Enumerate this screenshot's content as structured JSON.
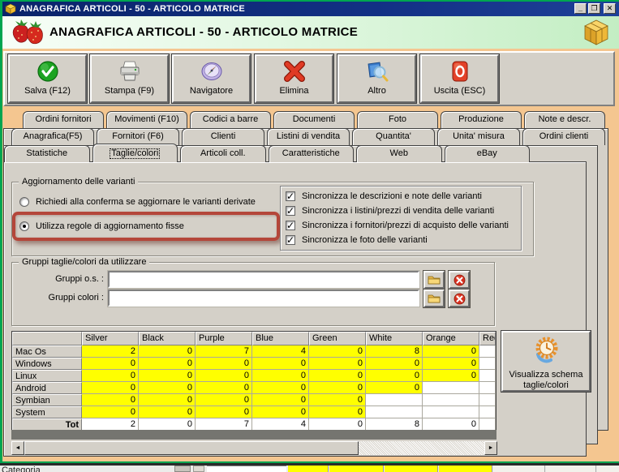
{
  "window": {
    "title": "ANAGRAFICA ARTICOLI - 50 - ARTICOLO MATRICE",
    "controls": {
      "minimize": "_",
      "maximize": "❐",
      "close": "✕"
    }
  },
  "header": {
    "title": "ANAGRAFICA ARTICOLI - 50 - ARTICOLO MATRICE"
  },
  "toolbar": {
    "buttons": [
      "Salva (F12)",
      "Stampa (F9)",
      "Navigatore",
      "Elimina",
      "Altro",
      "Uscita (ESC)"
    ]
  },
  "tabs": {
    "row1": [
      "Ordini fornitori",
      "Movimenti (F10)",
      "Codici a barre",
      "Documenti",
      "Foto",
      "Produzione",
      "Note e descr."
    ],
    "row2": [
      "Anagrafica(F5)",
      "Fornitori (F6)",
      "Clienti",
      "Listini di vendita",
      "Quantita'",
      "Unita' misura",
      "Ordini clienti"
    ],
    "row3": [
      "Statistiche",
      "Taglie/colori",
      "Articoli coll.",
      "Caratteristiche",
      "Web",
      "eBay"
    ],
    "active": "Taglie/colori"
  },
  "variants": {
    "group_title": "Aggiornamento delle varianti",
    "radio_options": [
      {
        "label": "Richiedi alla conferma se aggiornare le varianti derivate",
        "selected": false
      },
      {
        "label": "Utilizza regole di aggiornamento fisse",
        "selected": true
      }
    ],
    "sync_options": [
      {
        "label": "Sincronizza le descrizioni e note delle varianti",
        "checked": true
      },
      {
        "label": "Sincronizza i listini/prezzi di vendita delle varianti",
        "checked": true
      },
      {
        "label": "Sincronizza i fornitori/prezzi di acquisto delle varianti",
        "checked": true
      },
      {
        "label": "Sincronizza le foto delle varianti",
        "checked": true
      }
    ]
  },
  "groups": {
    "group_title": "Gruppi taglie/colori da utilizzare",
    "fields": [
      {
        "label": "Gruppi o.s. :",
        "value": ""
      },
      {
        "label": "Gruppi colori :",
        "value": ""
      }
    ]
  },
  "matrix": {
    "columns": [
      "Silver",
      "Black",
      "Purple",
      "Blue",
      "Green",
      "White",
      "Orange",
      "Red"
    ],
    "rows": [
      {
        "name": "Mac Os",
        "values": [
          2,
          0,
          7,
          4,
          0,
          8,
          0
        ]
      },
      {
        "name": "Windows",
        "values": [
          0,
          0,
          0,
          0,
          0,
          0,
          0
        ]
      },
      {
        "name": "Linux",
        "values": [
          0,
          0,
          0,
          0,
          0,
          0,
          0
        ]
      },
      {
        "name": "Android",
        "values": [
          0,
          0,
          0,
          0,
          0,
          0
        ]
      },
      {
        "name": "Symbian",
        "values": [
          0,
          0,
          0,
          0,
          0
        ]
      },
      {
        "name": "System",
        "values": [
          0,
          0,
          0,
          0,
          0
        ]
      }
    ],
    "total_row": {
      "label": "Tot",
      "values": [
        2,
        0,
        7,
        4,
        0,
        8,
        0
      ]
    }
  },
  "schema_button": {
    "label": "Visualizza schema taglie/colori"
  },
  "background_window": {
    "partial_text": "Categoria"
  },
  "colors": {
    "frame_green": "#00a550",
    "titlebar_navy": "#0a246a",
    "body_peach": "#f4c690",
    "panel_gray": "#d4d0c8",
    "cell_yellow": "#ffff00",
    "highlight_red": "#b4463a"
  }
}
